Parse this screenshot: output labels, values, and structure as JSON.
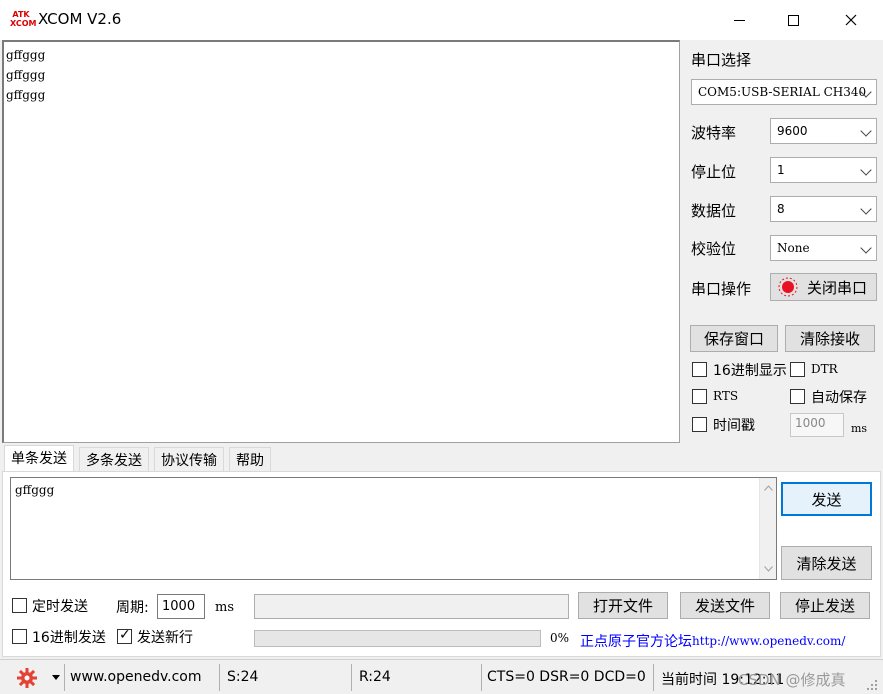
{
  "window": {
    "title": "XCOM V2.6",
    "logo_top": "ATK",
    "logo_bottom": "XCOM"
  },
  "receive": {
    "lines": [
      "gffggg",
      "gffggg",
      "gffggg"
    ]
  },
  "port_panel": {
    "header": "串口选择",
    "port_value": "COM5:USB-SERIAL CH340",
    "baud_label": "波特率",
    "baud_value": "9600",
    "stop_label": "停止位",
    "stop_value": "1",
    "data_label": "数据位",
    "data_value": "8",
    "parity_label": "校验位",
    "parity_value": "None",
    "op_label": "串口操作",
    "op_button": "关闭串口",
    "save_window": "保存窗口",
    "clear_receive": "清除接收",
    "hex_display": "16进制显示",
    "dtr": "DTR",
    "rts": "RTS",
    "auto_save": "自动保存",
    "timestamp": "时间戳",
    "timestamp_value": "1000",
    "timestamp_unit": "ms"
  },
  "tabs": [
    {
      "label": "单条发送",
      "active": true
    },
    {
      "label": "多条发送",
      "active": false
    },
    {
      "label": "协议传输",
      "active": false
    },
    {
      "label": "帮助",
      "active": false
    }
  ],
  "send": {
    "text": "gffggg",
    "send_button": "发送",
    "clear_send_button": "清除发送",
    "timed_send": "定时发送",
    "period_label": "周期:",
    "period_value": "1000",
    "period_unit": "ms",
    "open_file": "打开文件",
    "send_file": "发送文件",
    "stop_send": "停止发送",
    "hex_send": "16进制发送",
    "newline_send": "发送新行",
    "newline_checked": true,
    "progress_percent": "0%",
    "forum_label": "正点原子官方论坛",
    "forum_url": "http://www.openedv.com/"
  },
  "status": {
    "site": "www.openedv.com",
    "sent": "S:24",
    "received": "R:24",
    "signals": "CTS=0 DSR=0 DCD=0",
    "time_label": "当前时间 19:12:11",
    "watermark": "CSDN @修成真"
  },
  "colors": {
    "accent": "#0078d7",
    "record_red": "#e81123",
    "gear_red": "#e34234",
    "link_blue": "#0000ff"
  }
}
